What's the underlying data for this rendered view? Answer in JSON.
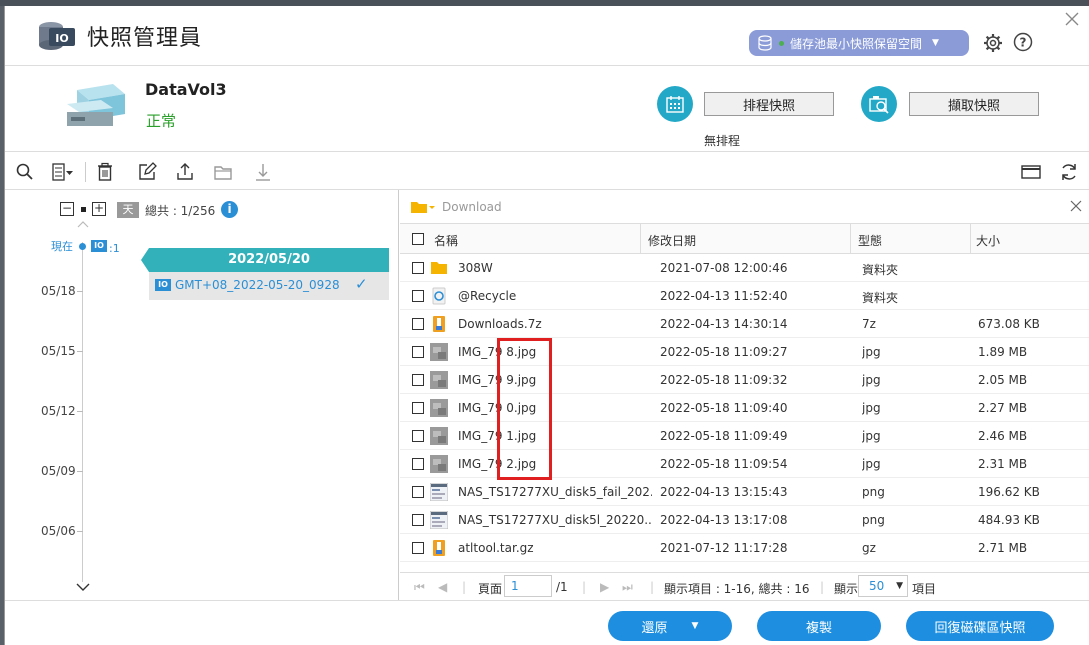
{
  "app": {
    "title": "快照管理員"
  },
  "header": {
    "pool_button": "儲存池最小快照保留空間"
  },
  "volume": {
    "name": "DataVol3",
    "status": "正常",
    "schedule_button": "排程快照",
    "schedule_status": "無排程",
    "take_button": "擷取快照"
  },
  "timeline": {
    "day_label": "天",
    "total": "總共 : 1/256",
    "now_label": "現在",
    "now_count": ":1",
    "dates": [
      "05/18",
      "05/15",
      "05/12",
      "05/09",
      "05/06"
    ],
    "snapshot": {
      "date": "2022/05/20",
      "name": "GMT+08_2022-05-20_0928"
    }
  },
  "browser": {
    "path": "Download",
    "columns": [
      "名稱",
      "修改日期",
      "型態",
      "大小"
    ],
    "rows": [
      {
        "name": "308W",
        "date": "2021-07-08 12:00:46",
        "type": "資料夾",
        "size": "",
        "icon": "folder-icon"
      },
      {
        "name": "@Recycle",
        "date": "2022-04-13 11:52:40",
        "type": "資料夾",
        "size": "",
        "icon": "recycle-icon"
      },
      {
        "name": "Downloads.7z",
        "date": "2022-04-13 14:30:14",
        "type": "7z",
        "size": "673.08 KB",
        "icon": "archive-icon"
      },
      {
        "name": "IMG_79 8.jpg",
        "date": "2022-05-18 11:09:27",
        "type": "jpg",
        "size": "1.89 MB",
        "icon": "image-thumb-icon"
      },
      {
        "name": "IMG_79 9.jpg",
        "date": "2022-05-18 11:09:32",
        "type": "jpg",
        "size": "2.05 MB",
        "icon": "image-thumb-icon"
      },
      {
        "name": "IMG_79 0.jpg",
        "date": "2022-05-18 11:09:40",
        "type": "jpg",
        "size": "2.27 MB",
        "icon": "image-thumb-icon"
      },
      {
        "name": "IMG_79 1.jpg",
        "date": "2022-05-18 11:09:49",
        "type": "jpg",
        "size": "2.46 MB",
        "icon": "image-thumb-icon"
      },
      {
        "name": "IMG_79 2.jpg",
        "date": "2022-05-18 11:09:54",
        "type": "jpg",
        "size": "2.31 MB",
        "icon": "image-thumb-icon"
      },
      {
        "name": "NAS_TS17277XU_disk5_fail_202...",
        "date": "2022-04-13 13:15:43",
        "type": "png",
        "size": "196.62 KB",
        "icon": "screenshot-thumb-icon"
      },
      {
        "name": "NAS_TS17277XU_disk5l_20220...",
        "date": "2022-04-13 13:17:08",
        "type": "png",
        "size": "484.93 KB",
        "icon": "screenshot-thumb-icon"
      },
      {
        "name": "atltool.tar.gz",
        "date": "2021-07-12 11:17:28",
        "type": "gz",
        "size": "2.71 MB",
        "icon": "archive-icon"
      }
    ]
  },
  "pager": {
    "page_label": "頁面",
    "page_value": "1",
    "page_total": "/1",
    "display_items": "顯示項目 : 1-16, 總共 : 16",
    "show_label": "顯示",
    "page_size": "50",
    "items_label": "項目"
  },
  "footer": {
    "restore": "還原",
    "copy": "複製",
    "revert": "回復磁碟區快照"
  },
  "colors": {
    "accent": "#1e8fe0",
    "teal": "#33b1bb",
    "status_ok": "#2aa02a",
    "highlight": "#e02020"
  }
}
